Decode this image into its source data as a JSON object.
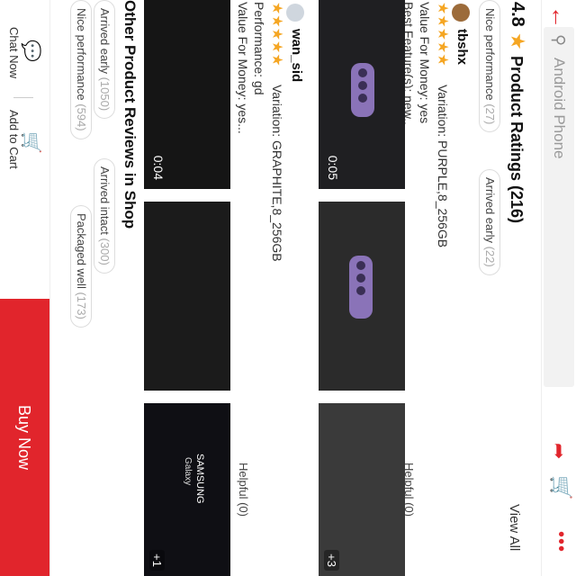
{
  "header": {
    "search_placeholder": "Android Phone",
    "icons": [
      "back-arrow-icon",
      "search-icon",
      "share-icon",
      "cart-icon",
      "more-icon"
    ],
    "accent": "#e1252c"
  },
  "ratings": {
    "score": "4.8",
    "title": "Product Ratings (216)",
    "view_all": "View All",
    "tags": [
      {
        "label": "Nice performance",
        "count": "(27)"
      },
      {
        "label": "Arrived early",
        "count": "(22)"
      }
    ]
  },
  "reviews": [
    {
      "user": "tbshx",
      "stars": 5,
      "variation": "Variation: PURPLE,8_256GB",
      "line1": "Value For Money: yes",
      "line2": "Best Feature(s): new..",
      "helpful": "Helpful (0)",
      "video_duration": "0:05",
      "extra_count": "+3"
    },
    {
      "user": "wan_sid",
      "stars": 5,
      "variation": "Variation: GRAPHITE,8_256GB",
      "line1": "Performance: gd",
      "line2": "Value For Money: yes...",
      "helpful": "Helpful (0)",
      "video_duration": "0:04",
      "extra_count": "+1",
      "photo_text": [
        "SAMSUNG",
        "Galaxy"
      ]
    }
  ],
  "shop_reviews": {
    "title": "Other Product Reviews in Shop",
    "tags_row1": [
      {
        "label": "Arrived early",
        "count": "(1050)"
      },
      {
        "label": "Arrived intact",
        "count": "(300)"
      }
    ],
    "tags_row2": [
      {
        "label": "Nice performance",
        "count": "(594)"
      },
      {
        "label": "Packaged well",
        "count": "(173)"
      }
    ]
  },
  "bottom_bar": {
    "chat_label": "Chat Now",
    "cart_label": "Add to Cart",
    "buy_label": "Buy Now"
  }
}
